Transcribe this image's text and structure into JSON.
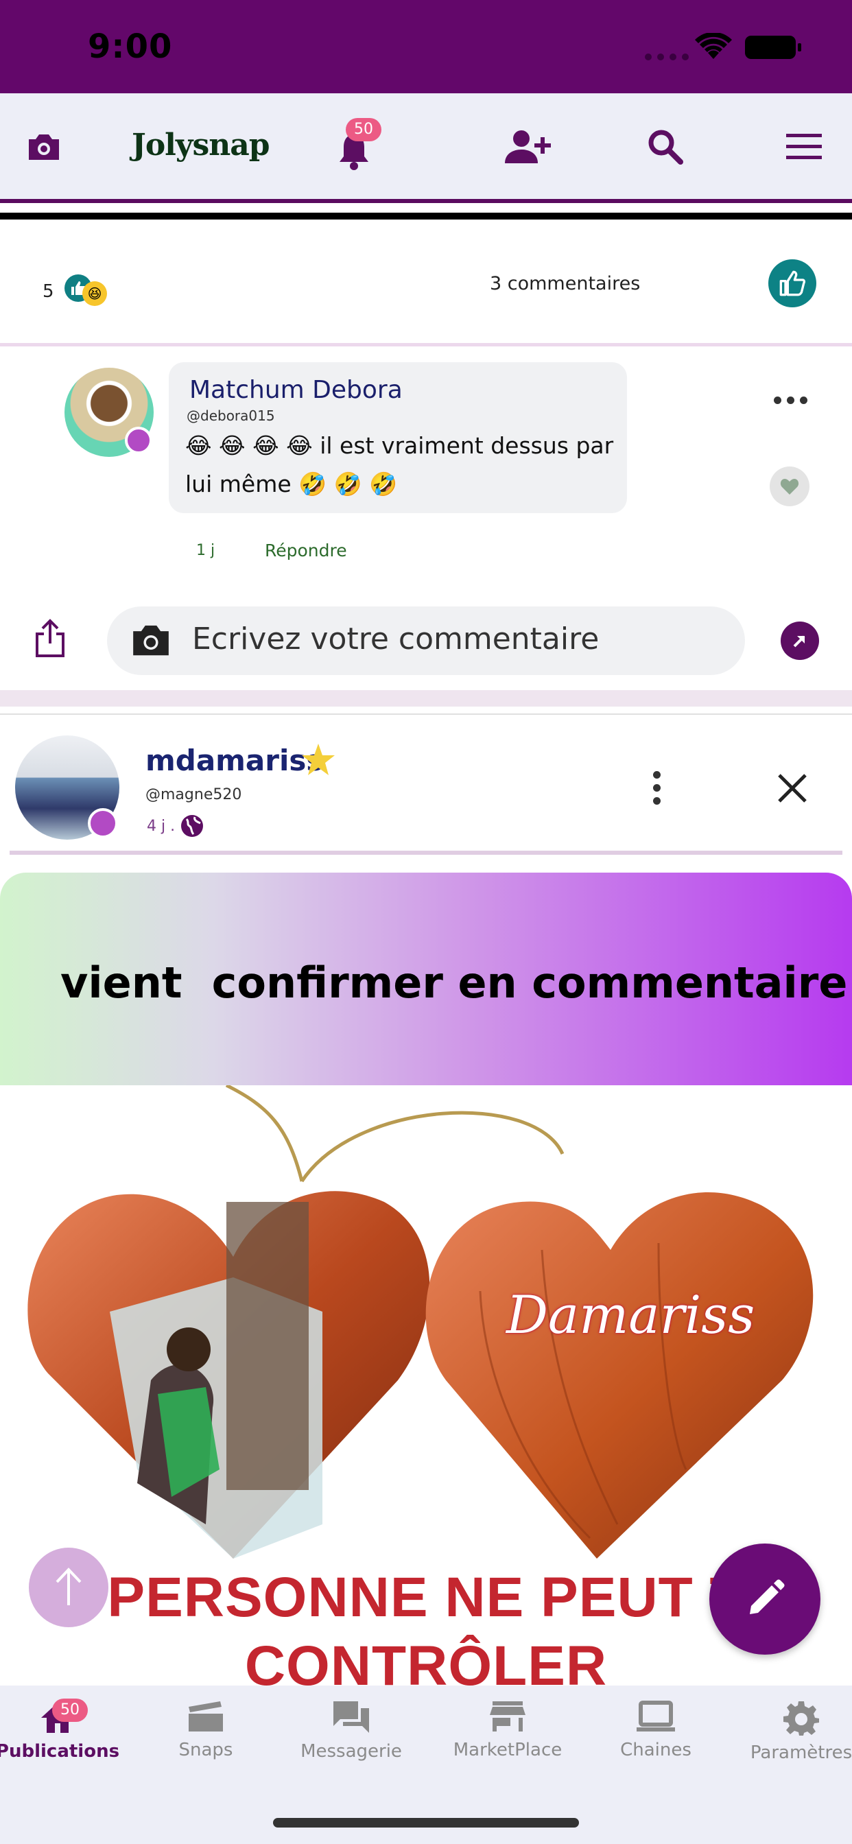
{
  "status": {
    "time": "9:00"
  },
  "header": {
    "logo": "Jolysnap",
    "notif_count": "50",
    "icons": [
      "camera-icon",
      "bell-icon",
      "add-user-icon",
      "search-icon",
      "menu-icon"
    ]
  },
  "reactions": {
    "count": "5",
    "comments": "3 commentaires"
  },
  "comment": {
    "author": "Matchum Debora",
    "handle": "@debora015",
    "text": "😂 😂 😂 😂 il est vraiment dessus par lui même 🤣 🤣 🤣",
    "time": "1 j",
    "reply": "Répondre"
  },
  "comment_input": {
    "placeholder": "Ecrivez votre commentaire"
  },
  "post": {
    "author": "mdamariss",
    "handle": "@magne520",
    "time": "4 j .",
    "text": "vient  confirmer en commentaire",
    "image_name_text": "Damariss",
    "image_caption_line1": "PERSONNE NE PEUT T",
    "image_caption_line2": "CONTRÔLER"
  },
  "bottom_nav": {
    "badge": "50",
    "items": [
      {
        "label": "Publications",
        "icon": "home-icon",
        "active": true
      },
      {
        "label": "Snaps",
        "icon": "clapper-icon",
        "active": false
      },
      {
        "label": "Messagerie",
        "icon": "chat-icon",
        "active": false
      },
      {
        "label": "MarketPlace",
        "icon": "store-icon",
        "active": false
      },
      {
        "label": "Chaines",
        "icon": "laptop-icon",
        "active": false
      },
      {
        "label": "Paramètres",
        "icon": "gear-icon",
        "active": false
      }
    ]
  },
  "colors": {
    "primary": "#63076a",
    "teal": "#0d8285",
    "badge": "#ec5a84",
    "online": "#b24ac4"
  }
}
